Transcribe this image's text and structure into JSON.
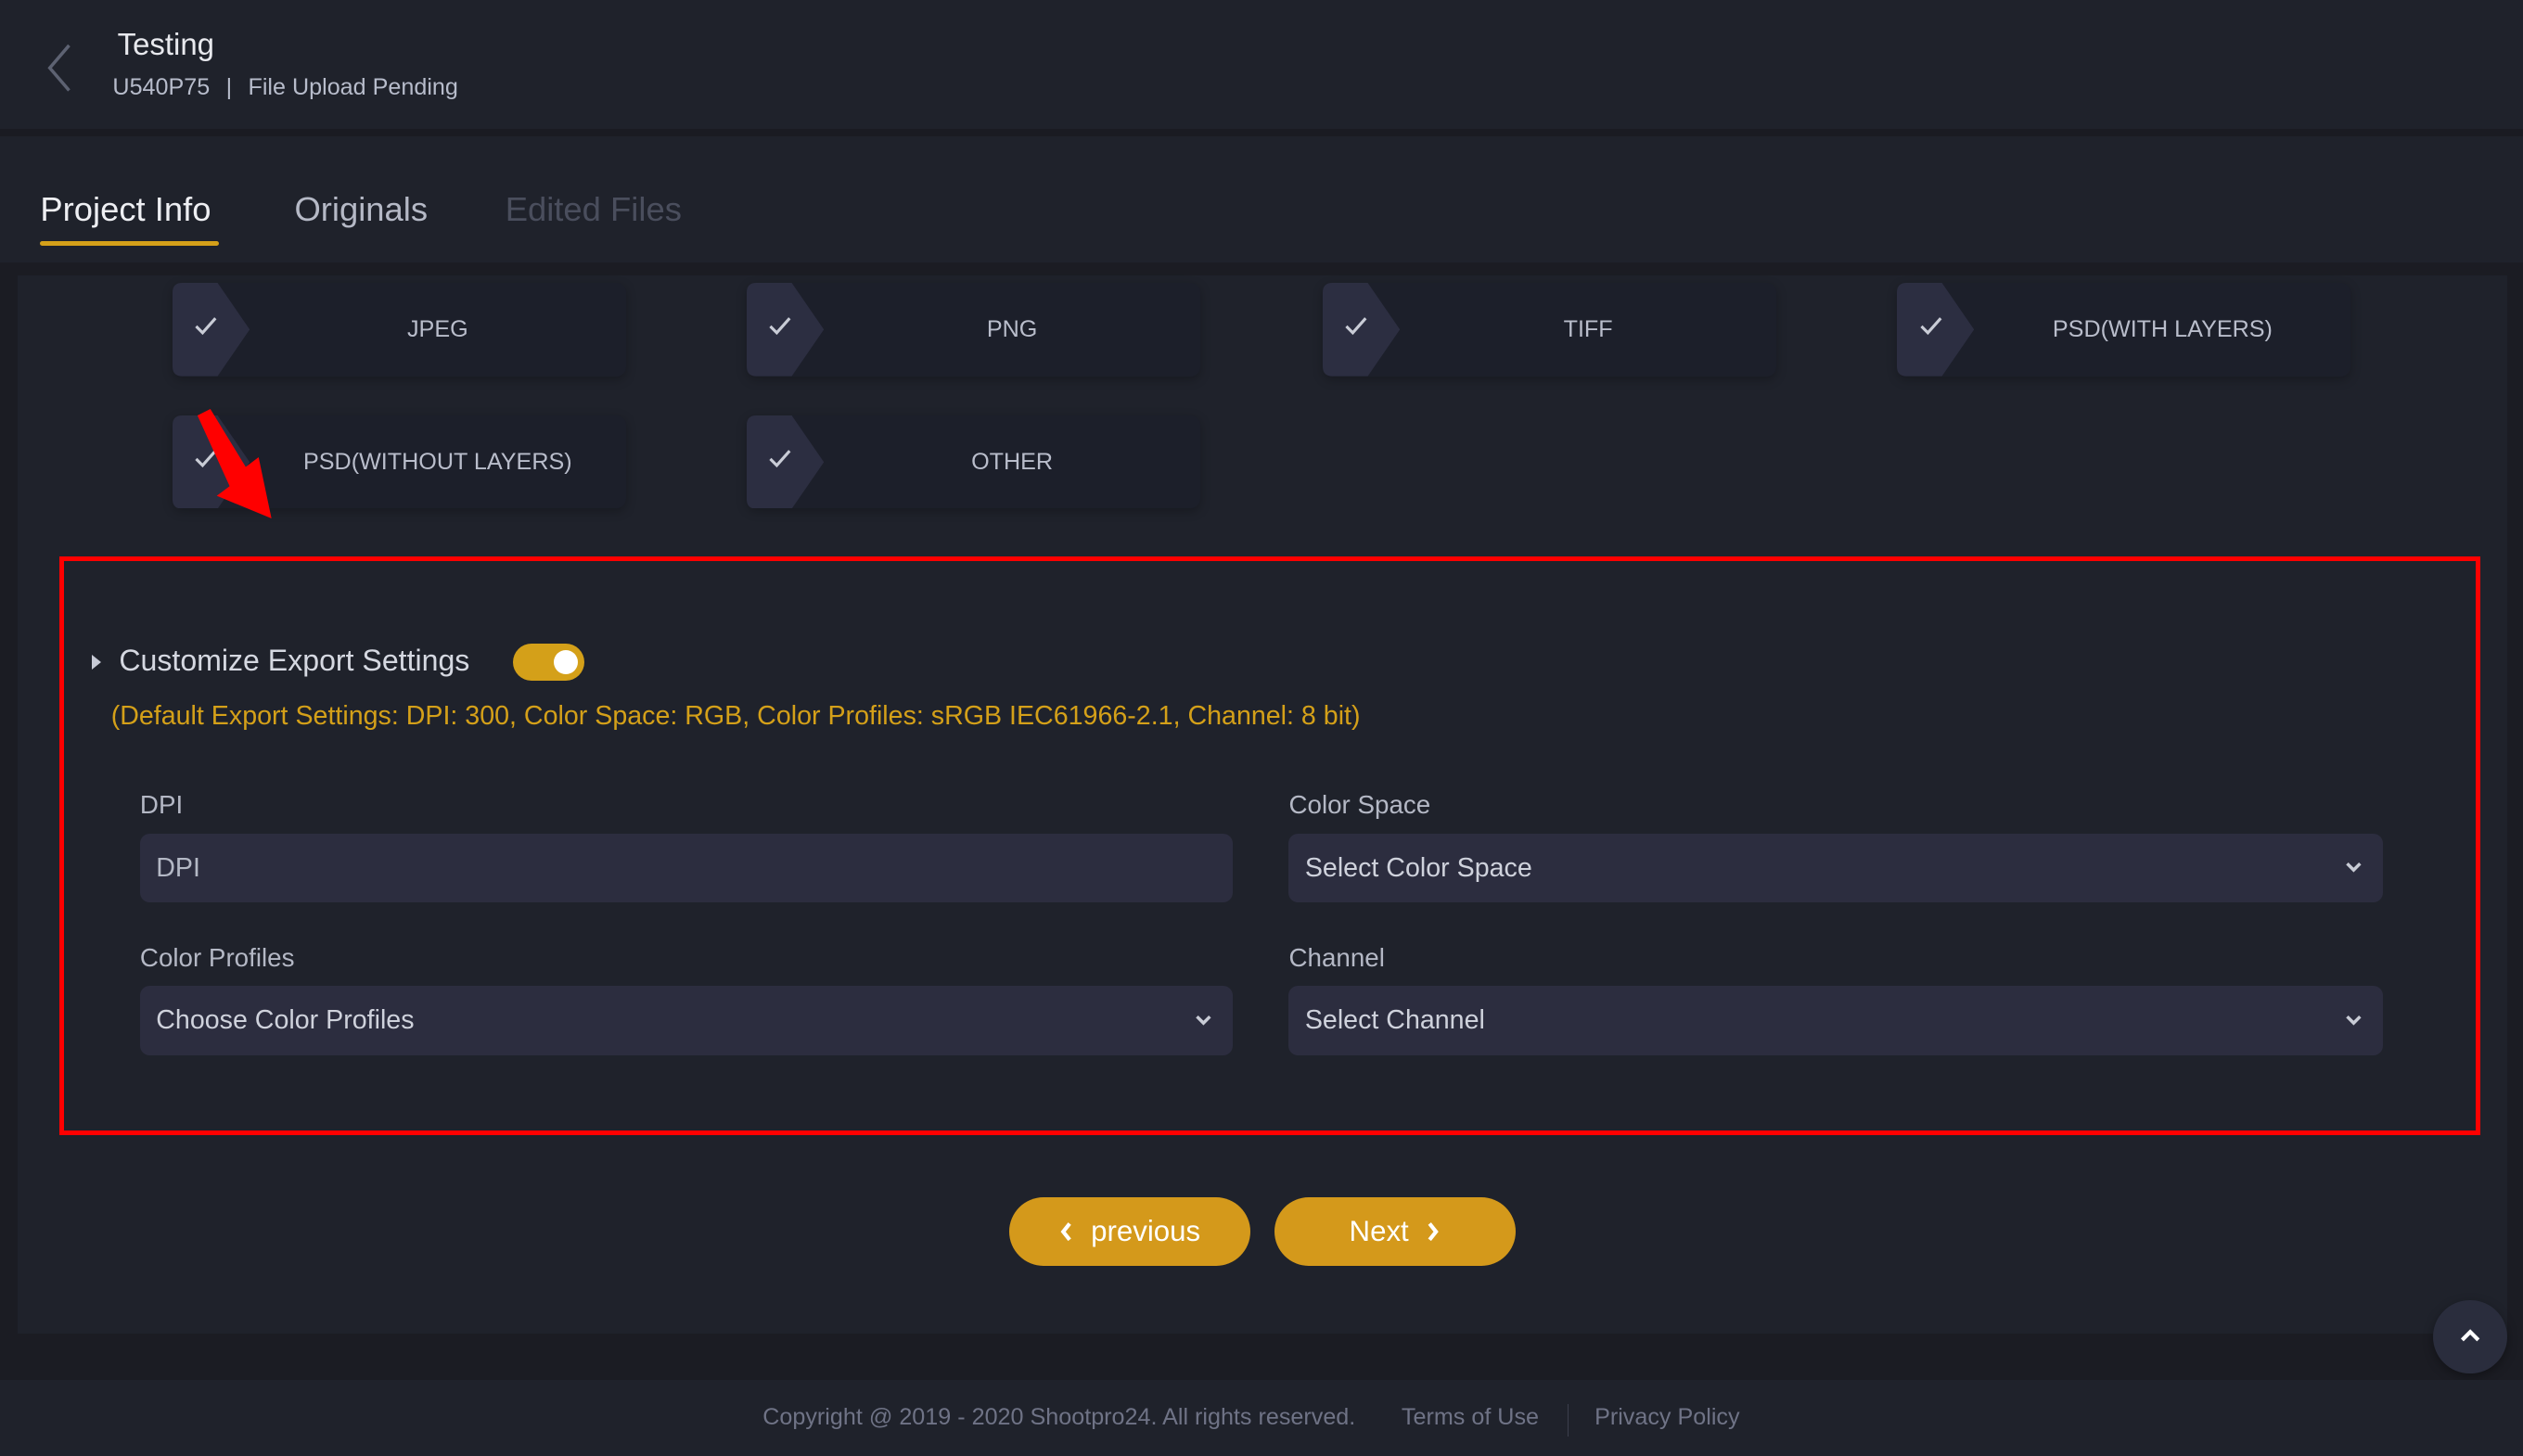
{
  "header": {
    "back_icon": "chevron-left-icon",
    "title": "Testing",
    "project_code": "U540P75",
    "separator": "|",
    "status": "File Upload Pending"
  },
  "tabs": [
    {
      "label": "Project Info",
      "state": "active"
    },
    {
      "label": "Originals",
      "state": "inactive"
    },
    {
      "label": "Edited Files",
      "state": "disabled"
    }
  ],
  "formats": [
    {
      "label": "JPEG",
      "checked": true
    },
    {
      "label": "PNG",
      "checked": true
    },
    {
      "label": "TIFF",
      "checked": true
    },
    {
      "label": "PSD(WITH LAYERS)",
      "checked": true
    },
    {
      "label": "PSD(WITHOUT LAYERS)",
      "checked": true
    },
    {
      "label": "OTHER",
      "checked": true
    }
  ],
  "annotation": {
    "highlight_color": "#ff0000",
    "arrow_icon": "red-arrow-icon"
  },
  "export_settings": {
    "label": "Customize Export Settings",
    "toggle_on": true,
    "defaults_text": "(Default Export Settings: DPI: 300, Color Space: RGB, Color Profiles: sRGB IEC61966-2.1, Channel: 8 bit)",
    "fields": {
      "dpi": {
        "label": "DPI",
        "placeholder": "DPI",
        "value": ""
      },
      "color_space": {
        "label": "Color Space",
        "selected": "Select Color Space"
      },
      "color_profiles": {
        "label": "Color Profiles",
        "selected": "Choose Color Profiles"
      },
      "channel": {
        "label": "Channel",
        "selected": "Select Channel"
      }
    }
  },
  "nav": {
    "previous_label": "previous",
    "next_label": "Next"
  },
  "scroll_top_icon": "chevron-up-icon",
  "footer": {
    "copyright": "Copyright @ 2019 - 2020 Shootpro24. All rights reserved.",
    "terms": "Terms of Use",
    "privacy": "Privacy Policy"
  },
  "colors": {
    "accent": "#d4a019",
    "background": "#1f222b",
    "field_bg": "#2c2d3f"
  }
}
